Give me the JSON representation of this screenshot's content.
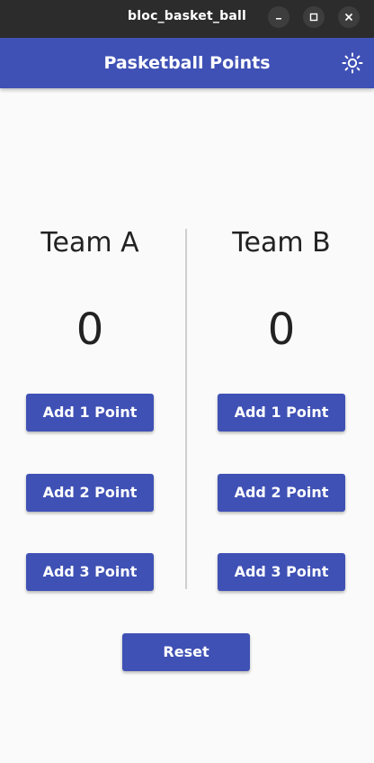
{
  "window": {
    "title": "bloc_basket_ball"
  },
  "appbar": {
    "title": "Pasketball Points",
    "theme_icon": "brightness-icon"
  },
  "teams": [
    {
      "name": "Team A",
      "score": "0",
      "buttons": [
        "Add 1 Point",
        "Add 2 Point",
        "Add 3 Point"
      ]
    },
    {
      "name": "Team B",
      "score": "0",
      "buttons": [
        "Add 1 Point",
        "Add 2 Point",
        "Add 3 Point"
      ]
    }
  ],
  "reset_label": "Reset",
  "colors": {
    "primary": "#3f51b5",
    "background": "#fafafa",
    "titlebar": "#2c2c2c"
  }
}
